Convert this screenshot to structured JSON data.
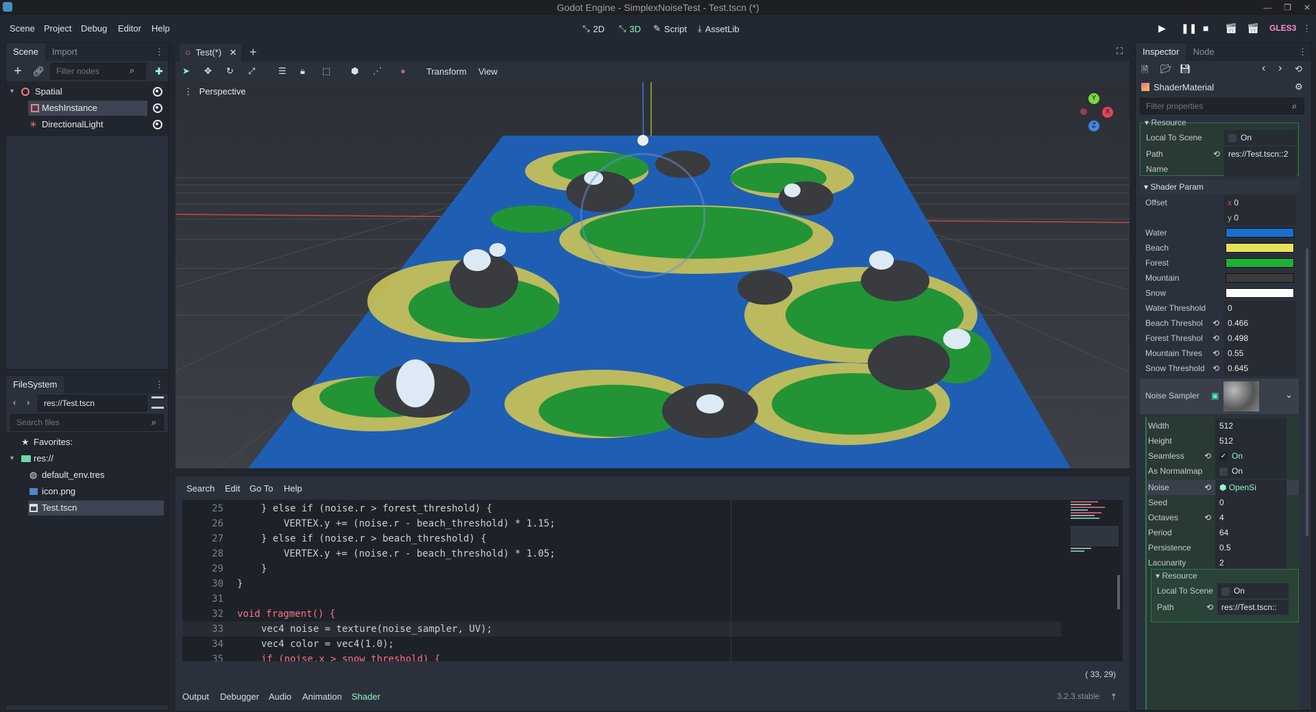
{
  "window": {
    "title": "Godot Engine - SimplexNoiseTest - Test.tscn (*)"
  },
  "menu": [
    "Scene",
    "Project",
    "Debug",
    "Editor",
    "Help"
  ],
  "workspaces": [
    {
      "label": "2D",
      "icon": "2d-icon"
    },
    {
      "label": "3D",
      "icon": "3d-icon"
    },
    {
      "label": "Script",
      "icon": "script-icon"
    },
    {
      "label": "AssetLib",
      "icon": "assetlib-icon"
    }
  ],
  "renderer": "GLES3",
  "scene_dock": {
    "tabs": [
      "Scene",
      "Import"
    ],
    "filter_placeholder": "Filter nodes",
    "nodes": [
      {
        "label": "Spatial",
        "icon": "spatial-node-icon"
      },
      {
        "label": "MeshInstance",
        "icon": "mesh-instance-icon"
      },
      {
        "label": "DirectionalLight",
        "icon": "directional-light-icon"
      }
    ]
  },
  "filesystem_dock": {
    "title": "FileSystem",
    "path": "res://Test.tscn",
    "search_placeholder": "Search files",
    "favorites": "Favorites:",
    "root": "res://",
    "files": [
      "default_env.tres",
      "icon.png",
      "Test.tscn"
    ]
  },
  "editor_tabs": [
    {
      "label": "Test(*)"
    }
  ],
  "viewport": {
    "toolbar_menus": [
      "Transform",
      "View"
    ],
    "perspective_label": "Perspective",
    "gizmo_axes": [
      "Y",
      "X",
      "Z"
    ]
  },
  "shader_editor": {
    "menus": [
      "Search",
      "Edit",
      "Go To",
      "Help"
    ],
    "cursor_position": "( 33, 29)",
    "lines": [
      {
        "n": "25",
        "text": "} else if (noise.r > forest_threshold) {"
      },
      {
        "n": "26",
        "text": "VERTEX.y += (noise.r - beach_threshold) * 1.15;"
      },
      {
        "n": "27",
        "text": "} else if (noise.r > beach_threshold) {"
      },
      {
        "n": "28",
        "text": "VERTEX.y += (noise.r - beach_threshold) * 1.05;"
      },
      {
        "n": "29",
        "text": "}"
      },
      {
        "n": "30",
        "text": "}"
      },
      {
        "n": "31",
        "text": ""
      },
      {
        "n": "32",
        "text": "void fragment() {"
      },
      {
        "n": "33",
        "text": "vec4 noise = texture(noise_sampler, UV);"
      },
      {
        "n": "34",
        "text": "vec4 color = vec4(1.0);"
      },
      {
        "n": "35",
        "text": "if (noise.x > snow_threshold) {"
      }
    ]
  },
  "bottom_panel": {
    "tabs": [
      "Output",
      "Debugger",
      "Audio",
      "Animation",
      "Shader"
    ],
    "active": "Shader",
    "version": "3.2.3.stable"
  },
  "inspector": {
    "tabs": [
      "Inspector",
      "Node"
    ],
    "resource_type": "ShaderMaterial",
    "filter_placeholder": "Filter properties",
    "resource_section": "Resource",
    "local_to_scene": {
      "label": "Local To Scene",
      "value": "On"
    },
    "path": {
      "label": "Path",
      "value": "res://Test.tscn::2"
    },
    "name": {
      "label": "Name",
      "value": ""
    },
    "shader_param_section": "Shader Param",
    "offset": {
      "label": "Offset",
      "x": "0",
      "y": "0"
    },
    "colors": [
      {
        "label": "Water",
        "color": "#1a6fcf"
      },
      {
        "label": "Beach",
        "color": "#e4e35a"
      },
      {
        "label": "Forest",
        "color": "#1fb136"
      },
      {
        "label": "Mountain",
        "color": "#3b3b3b"
      },
      {
        "label": "Snow",
        "color": "#ffffff"
      }
    ],
    "thresholds": [
      {
        "label": "Water Threshold",
        "value": "0",
        "revert": false
      },
      {
        "label": "Beach Threshol",
        "value": "0.466",
        "revert": true
      },
      {
        "label": "Forest Threshol",
        "value": "0.498",
        "revert": true
      },
      {
        "label": "Mountain Thres",
        "value": "0.55",
        "revert": true
      },
      {
        "label": "Snow Threshold",
        "value": "0.645",
        "revert": true
      }
    ],
    "noise_sampler": {
      "label": "Noise Sampler"
    },
    "noise_props": [
      {
        "label": "Width",
        "value": "512"
      },
      {
        "label": "Height",
        "value": "512"
      },
      {
        "label": "Seamless",
        "value": "On"
      },
      {
        "label": "As Normalmap",
        "value": "On"
      },
      {
        "label": "Noise",
        "value": "OpenSi"
      },
      {
        "label": "Seed",
        "value": "0"
      },
      {
        "label": "Octaves",
        "value": "4"
      },
      {
        "label": "Period",
        "value": "64"
      },
      {
        "label": "Persistence",
        "value": "0.5"
      },
      {
        "label": "Lacunarity",
        "value": "2"
      }
    ],
    "sub_resource": {
      "section": "Resource",
      "local_to_scene": "Local To Scene",
      "local_value": "On",
      "path_label": "Path",
      "path_value": "res://Test.tscn::"
    }
  }
}
